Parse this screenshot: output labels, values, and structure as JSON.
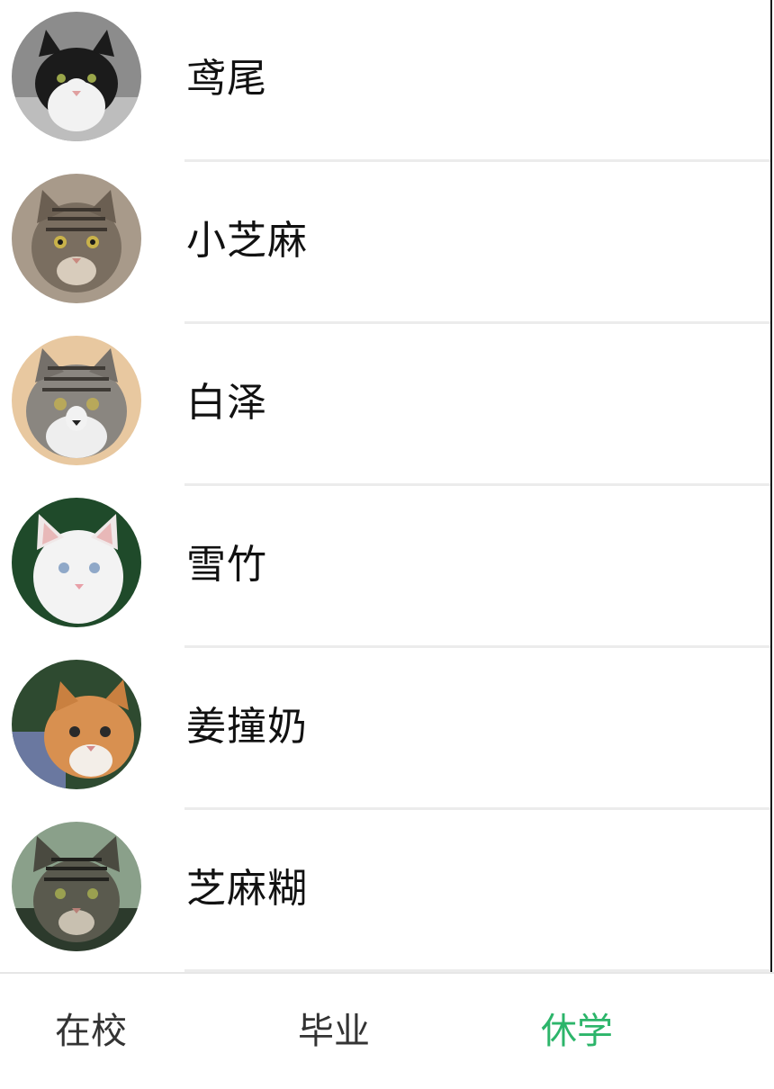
{
  "cats": [
    {
      "name": "鸢尾",
      "avatar": "black-white-cat-photo"
    },
    {
      "name": "小芝麻",
      "avatar": "gray-tabby-cat-photo"
    },
    {
      "name": "白泽",
      "avatar": "long-hair-tabby-cat-photo"
    },
    {
      "name": "雪竹",
      "avatar": "white-cat-photo"
    },
    {
      "name": "姜撞奶",
      "avatar": "orange-white-cat-photo"
    },
    {
      "name": "芝麻糊",
      "avatar": "tabby-kitten-photo"
    }
  ],
  "tabs": [
    {
      "label": "在校",
      "active": false
    },
    {
      "label": "毕业",
      "active": false
    },
    {
      "label": "休学",
      "active": true
    }
  ],
  "colors": {
    "active_tab": "#2cb56a",
    "inactive_tab": "#333333",
    "divider": "#ececec"
  }
}
